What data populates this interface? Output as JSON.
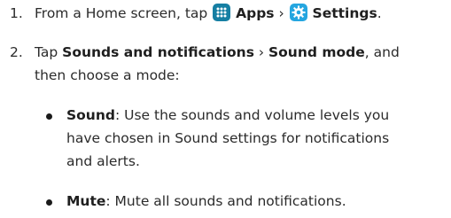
{
  "steps": [
    {
      "number": "1.",
      "prefix": "From a Home screen, tap ",
      "apps": "Apps",
      "sep": " › ",
      "settings": "Settings",
      "end": "."
    },
    {
      "number": "2.",
      "prefix": "Tap ",
      "sounds": "Sounds and notifications",
      "sep": " › ",
      "mode": "Sound mode",
      "suffix": ", and",
      "line2": "then choose a mode:"
    }
  ],
  "modes": [
    {
      "term": "Sound",
      "desc": ": Use the sounds and volume levels you",
      "line2": "have chosen in Sound settings for notifications",
      "line3": "and alerts."
    },
    {
      "term": "Mute",
      "desc": ": Mute all sounds and notifications."
    }
  ],
  "icons": {
    "apps": "apps-grid-icon",
    "settings": "settings-gear-icon"
  },
  "colors": {
    "apps_icon": "#167fa3",
    "settings_icon": "#25a6e0"
  }
}
